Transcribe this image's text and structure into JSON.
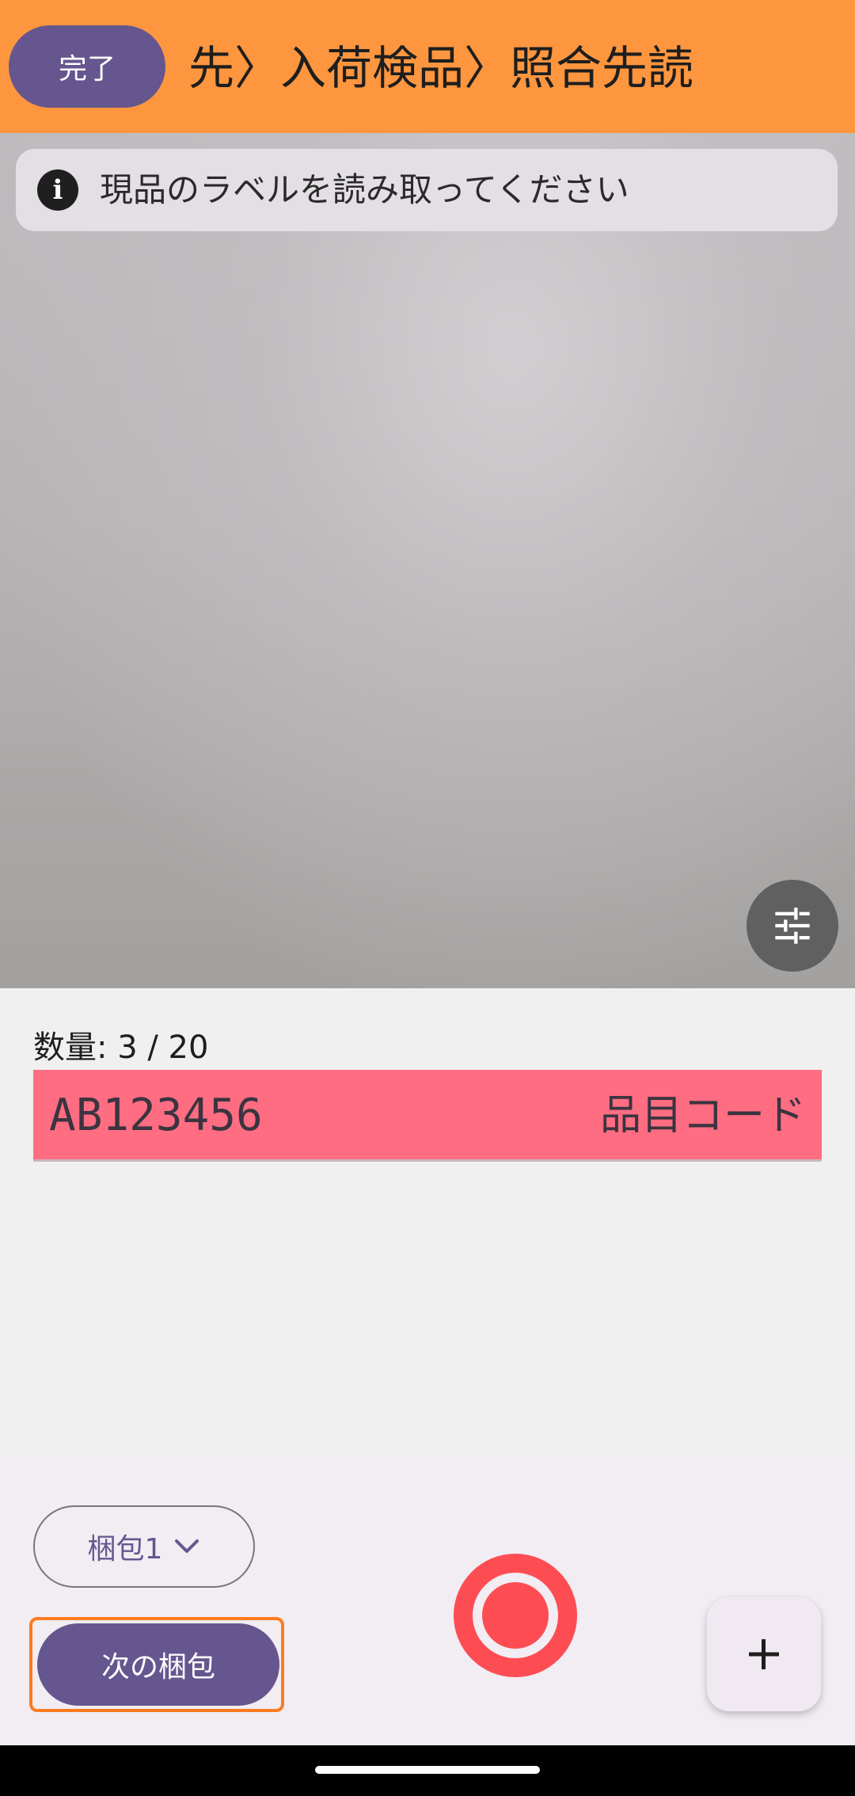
{
  "appbar": {
    "done_label": "完了",
    "breadcrumb": "先〉入荷検品〉照合先読"
  },
  "camera": {
    "info_icon_glyph": "i",
    "info_text": "現品のラベルを読み取ってください",
    "settings_icon": "tune-icon"
  },
  "content": {
    "quantity_label": "数量: 3 / 20",
    "code_value": "AB123456",
    "code_label": "品目コード",
    "code_field_color": "#ff6d82"
  },
  "bottom": {
    "package_select_value": "梱包1",
    "next_package_label": "次の梱包",
    "capture_icon": "record-icon",
    "add_icon": "plus-icon"
  },
  "colors": {
    "appbar": "#fd963f",
    "primary": "#66568f",
    "capture": "#fd4d53",
    "highlight_border": "#fd7b1f"
  }
}
